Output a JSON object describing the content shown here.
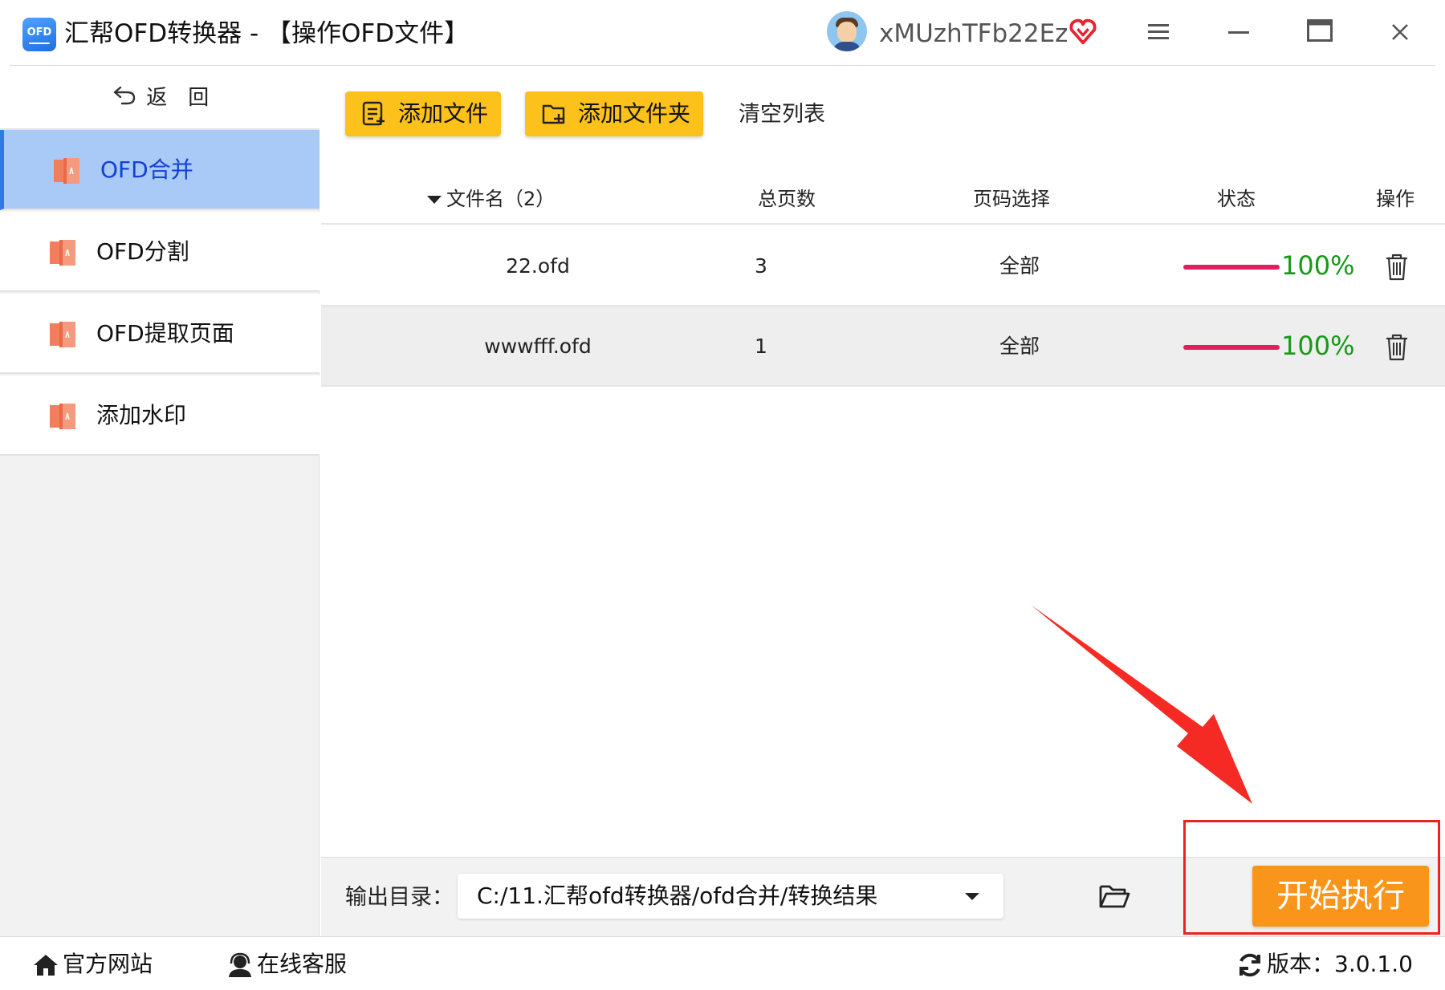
{
  "titlebar": {
    "app_title": "汇帮OFD转换器 - 【操作OFD文件】",
    "logo_text": "OFD",
    "username": "xMUzhTFb22Ez",
    "icons": [
      "avatar",
      "vip-heart-icon",
      "menu-icon",
      "minimize-icon",
      "maximize-icon",
      "close-icon"
    ]
  },
  "sidebar": {
    "back_label": "返　回",
    "items": [
      {
        "label": "OFD合并",
        "active": true
      },
      {
        "label": "OFD分割",
        "active": false
      },
      {
        "label": "OFD提取页面",
        "active": false
      },
      {
        "label": "添加水印",
        "active": false
      }
    ]
  },
  "toolbar": {
    "add_file": "添加文件",
    "add_folder": "添加文件夹",
    "clear_list": "清空列表"
  },
  "table": {
    "headers": {
      "filename": "文件名（2）",
      "pages": "总页数",
      "page_select": "页码选择",
      "status": "状态",
      "action": "操作"
    },
    "rows": [
      {
        "filename": "22.ofd",
        "pages": "3",
        "page_select": "全部",
        "progress": "100%"
      },
      {
        "filename": "wwwfff.ofd",
        "pages": "1",
        "page_select": "全部",
        "progress": "100%"
      }
    ]
  },
  "output": {
    "label": "输出目录：",
    "path": "C:/11.汇帮ofd转换器/ofd合并/转换结果",
    "start_button": "开始执行"
  },
  "footer": {
    "website": "官方网站",
    "support": "在线客服",
    "version": "版本：3.0.1.0"
  },
  "colors": {
    "accent_yellow": "#fcc21b",
    "start_orange": "#fa951c",
    "active_nav": "#a9c9f6",
    "progress_bar": "#e21e5f",
    "progress_text": "#169a16",
    "annotation_red": "#ef2020"
  }
}
